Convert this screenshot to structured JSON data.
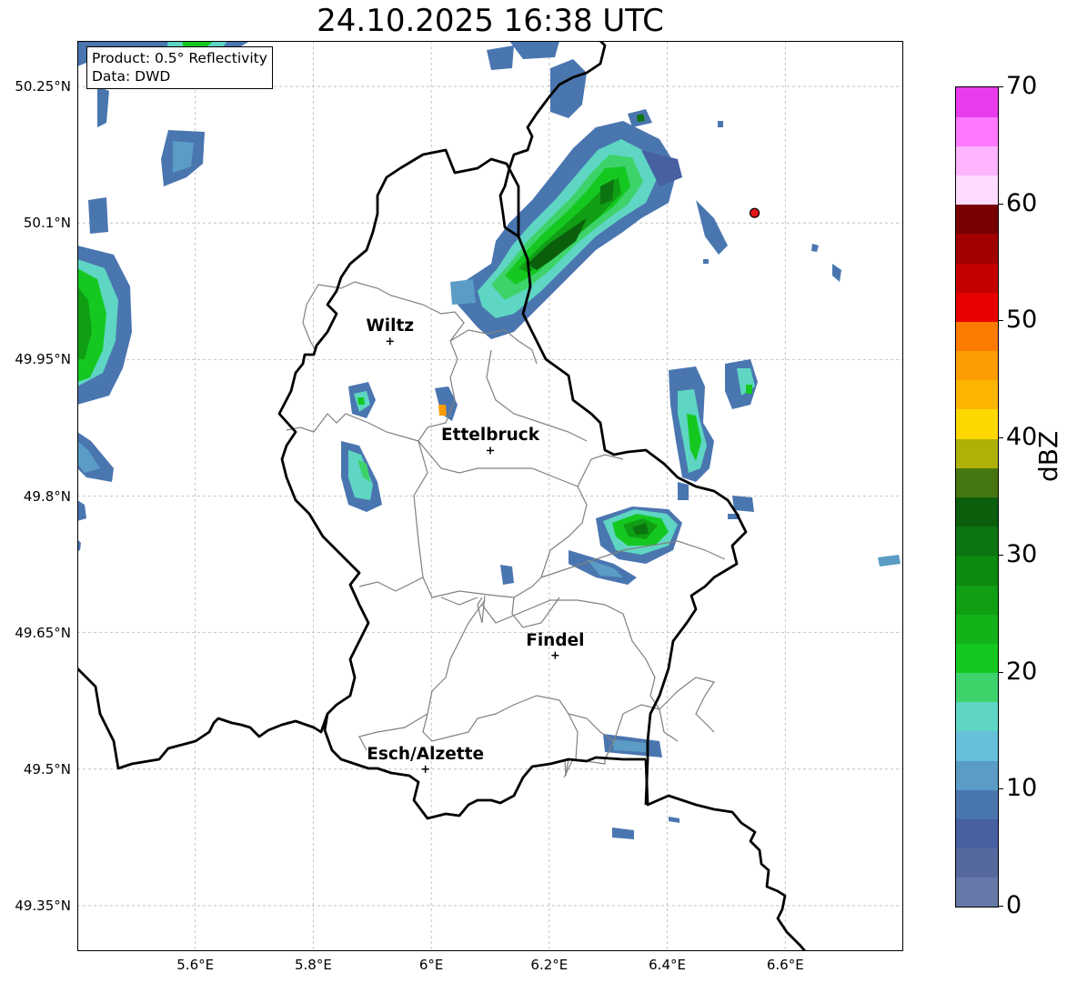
{
  "title": "24.10.2025 16:38 UTC",
  "info": {
    "product": "Product: 0.5° Reflectivity",
    "data": "Data: DWD"
  },
  "map": {
    "lon_range": [
      5.4,
      6.8
    ],
    "lat_range": [
      49.3,
      50.3
    ],
    "lat_ticks": [
      {
        "value": 50.25,
        "label": "50.25°N"
      },
      {
        "value": 50.1,
        "label": "50.1°N"
      },
      {
        "value": 49.95,
        "label": "49.95°N"
      },
      {
        "value": 49.8,
        "label": "49.8°N"
      },
      {
        "value": 49.65,
        "label": "49.65°N"
      },
      {
        "value": 49.5,
        "label": "49.5°N"
      },
      {
        "value": 49.35,
        "label": "49.35°N"
      }
    ],
    "lon_ticks": [
      {
        "value": 5.6,
        "label": "5.6°E"
      },
      {
        "value": 5.8,
        "label": "5.8°E"
      },
      {
        "value": 6.0,
        "label": "6°E"
      },
      {
        "value": 6.2,
        "label": "6.2°E"
      },
      {
        "value": 6.4,
        "label": "6.4°E"
      },
      {
        "value": 6.6,
        "label": "6.6°E"
      }
    ],
    "cities": [
      {
        "name": "Wiltz",
        "lon": 5.93,
        "lat": 49.97
      },
      {
        "name": "Ettelbruck",
        "lon": 6.1,
        "lat": 49.85
      },
      {
        "name": "Findel",
        "lon": 6.21,
        "lat": 49.625
      },
      {
        "name": "Esch/Alzette",
        "lon": 5.99,
        "lat": 49.5
      }
    ],
    "radar_site": {
      "lon": 6.548,
      "lat": 50.111,
      "color": "#e8141c"
    }
  },
  "colorbar": {
    "label": "dBZ",
    "min": 0,
    "max": 70,
    "ticks": [
      {
        "value": 0,
        "label": "0"
      },
      {
        "value": 10,
        "label": "10"
      },
      {
        "value": 20,
        "label": "20"
      },
      {
        "value": 30,
        "label": "30"
      },
      {
        "value": 40,
        "label": "40"
      },
      {
        "value": 50,
        "label": "50"
      },
      {
        "value": 60,
        "label": "60"
      },
      {
        "value": 70,
        "label": "70"
      }
    ],
    "colors": [
      "#6578a8",
      "#55699f",
      "#4760a2",
      "#4a76b0",
      "#5b9cc6",
      "#67bfd9",
      "#5ed6c3",
      "#3dd36a",
      "#14c820",
      "#12b218",
      "#109e14",
      "#0d8a10",
      "#0c7410",
      "#0a5e0c",
      "#467610",
      "#aeb208",
      "#fdd800",
      "#fbb400",
      "#fb9c00",
      "#fb7a00",
      "#e80000",
      "#c40000",
      "#a00000",
      "#780000",
      "#ffdcff",
      "#ffb4ff",
      "#ff78ff",
      "#e83cec"
    ]
  }
}
